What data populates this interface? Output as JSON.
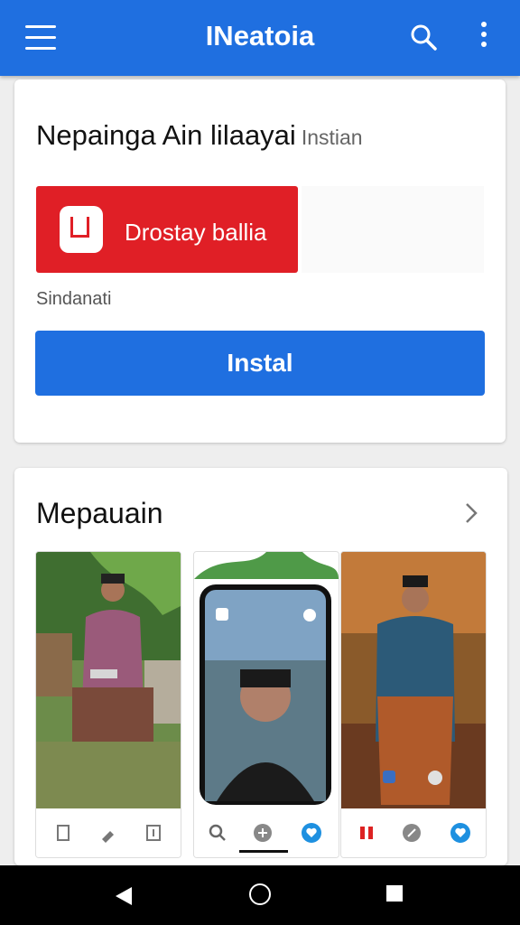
{
  "appbar": {
    "title": "INeatoia",
    "icons": [
      "menu-icon",
      "search-icon",
      "more-vert-icon"
    ],
    "color": "#1f6fe0"
  },
  "app_card": {
    "title": "Nepainga Ain lilaayai",
    "subtitle": "Instian",
    "promo_label": "Drostay ballia",
    "promo_color": "#e01f26",
    "small_text": "Sindanati",
    "install_label": "Instal"
  },
  "screens_card": {
    "title": "Mepauain",
    "chevron_icon": "chevron-right-icon",
    "screenshots": [
      {
        "name": "screenshot-1",
        "icons": [
          "page-icon",
          "brush-icon",
          "info-icon"
        ]
      },
      {
        "name": "screenshot-2",
        "icons": [
          "search-icon",
          "add-icon",
          "heart-icon"
        ]
      },
      {
        "name": "screenshot-3",
        "icons": [
          "flag-icon",
          "compass-icon",
          "heart-icon"
        ]
      }
    ]
  },
  "navbar": {
    "icons": [
      "back-icon",
      "home-icon",
      "recents-icon"
    ]
  }
}
